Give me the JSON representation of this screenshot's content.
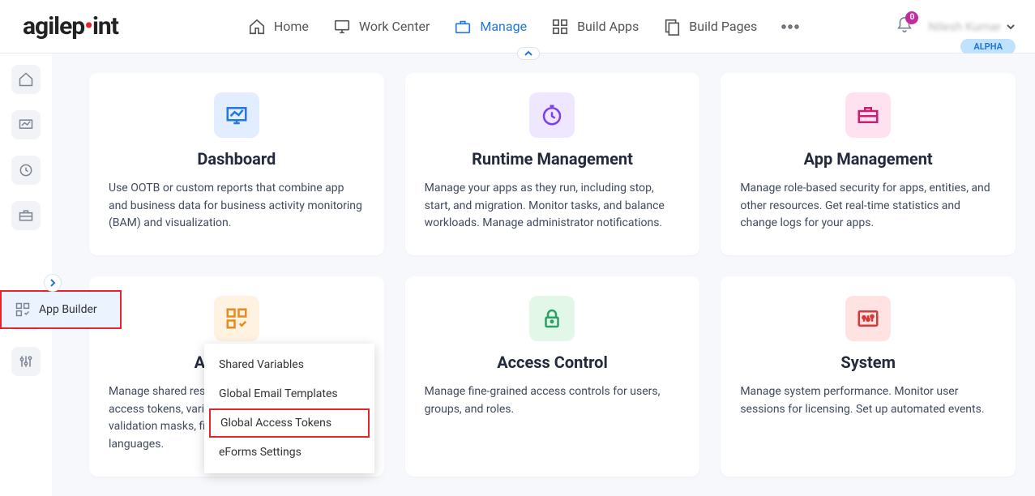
{
  "header": {
    "logo_left": "agilep",
    "logo_right": "int",
    "nav": [
      {
        "label": "Home"
      },
      {
        "label": "Work Center"
      },
      {
        "label": "Manage"
      },
      {
        "label": "Build Apps"
      },
      {
        "label": "Build Pages"
      }
    ],
    "bell_count": "0",
    "username": "Nilesh Kumar",
    "alpha": "ALPHA"
  },
  "sidebar": {
    "expanded_label": "App Builder"
  },
  "submenu": {
    "items": [
      "Shared Variables",
      "Global Email Templates",
      "Global Access Tokens",
      "eForms Settings"
    ]
  },
  "cards": [
    {
      "title": "Dashboard",
      "desc": "Use OOTB or custom reports that combine app and business data for business activity monitoring (BAM) and visualization.",
      "bg": "#e2edff",
      "stroke": "#2277e0"
    },
    {
      "title": "Runtime Management",
      "desc": "Manage your apps as they run, including stop, start, and migration. Monitor tasks, and balance workloads. Manage administrator notifications.",
      "bg": "#efe6ff",
      "stroke": "#7a3ff0"
    },
    {
      "title": "App Management",
      "desc": "Manage role-based security for apps, entities, and other resources. Get real-time statistics and change logs for your apps.",
      "bg": "#ffe1ef",
      "stroke": "#c92073"
    },
    {
      "title": "App Builder",
      "desc": "Manage shared resources for your apps, such as access tokens, variables, e-mail templates, validation masks, file type groups, lists, and languages.",
      "bg": "#fff2e0",
      "stroke": "#e78b1e"
    },
    {
      "title": "Access Control",
      "desc": "Manage fine-grained access controls for users, groups, and roles.",
      "bg": "#e3f7e9",
      "stroke": "#28a264"
    },
    {
      "title": "System",
      "desc": "Manage system performance. Monitor user sessions for licensing. Set up automated events.",
      "bg": "#ffe3e3",
      "stroke": "#d43a3a"
    }
  ]
}
